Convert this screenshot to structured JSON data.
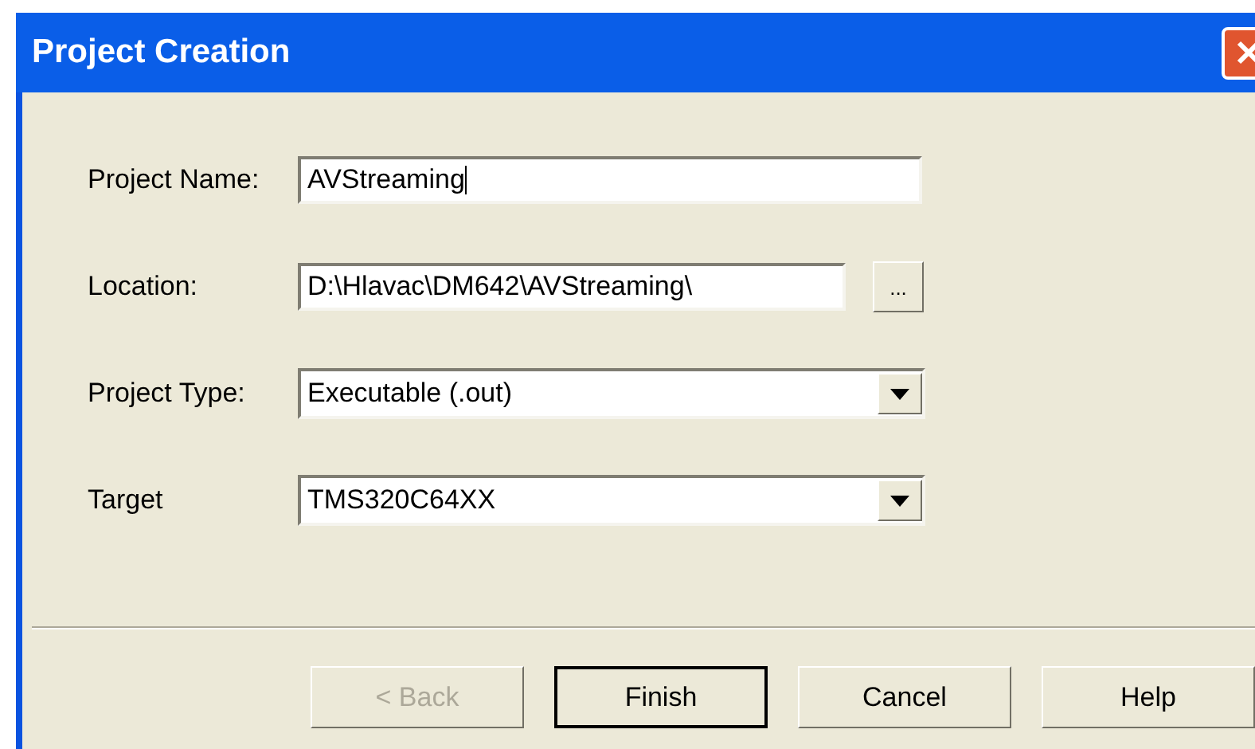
{
  "window": {
    "title": "Project Creation"
  },
  "fields": [
    {
      "label": "Project Name:",
      "kind": "text",
      "value": "AVStreaming"
    },
    {
      "label": "Location:",
      "kind": "browse",
      "value": "D:\\Hlavac\\DM642\\AVStreaming\\",
      "button": "..."
    },
    {
      "label": "Project Type:",
      "kind": "dropdown",
      "value": "Executable (.out)"
    },
    {
      "label": "Target",
      "kind": "dropdown",
      "value": "TMS320C64XX"
    }
  ],
  "buttons": [
    {
      "label": "< Back",
      "disabled": true,
      "default": false
    },
    {
      "label": "Finish",
      "disabled": false,
      "default": true
    },
    {
      "label": "Cancel",
      "disabled": false,
      "default": false
    },
    {
      "label": "Help",
      "disabled": false,
      "default": false
    }
  ]
}
